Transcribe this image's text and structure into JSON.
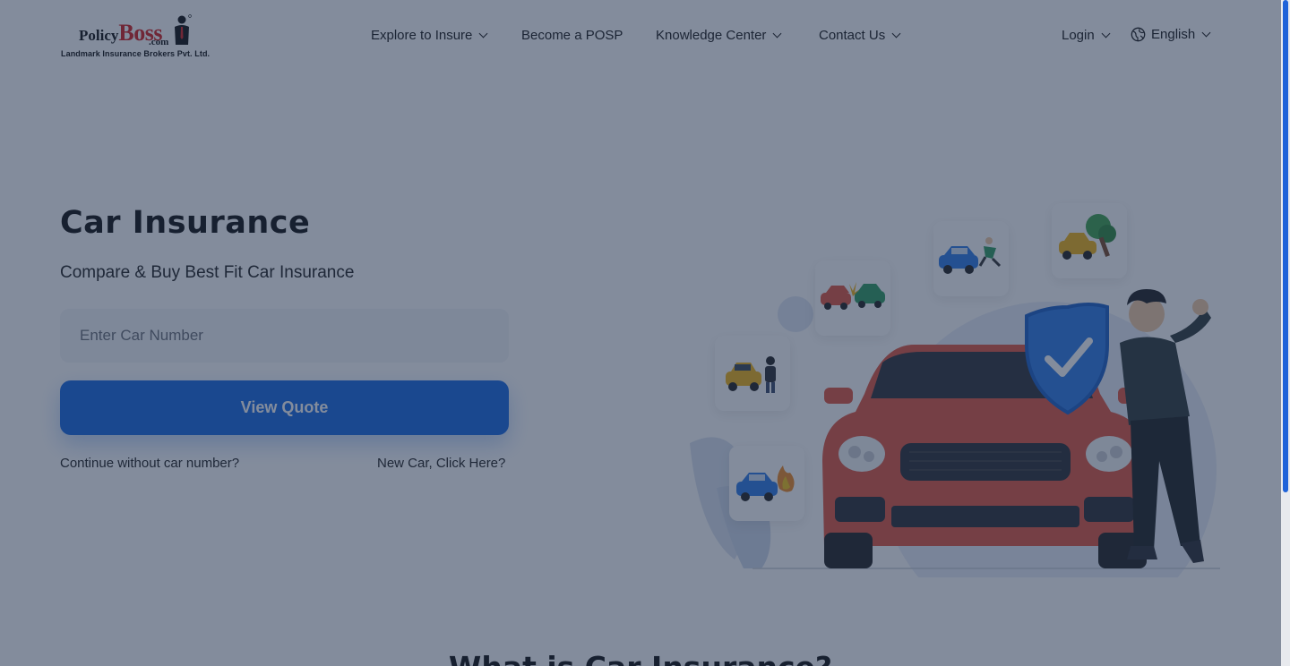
{
  "logo": {
    "policy": "Policy",
    "boss": "Boss",
    "com": ".com",
    "subtitle": "Landmark Insurance Brokers Pvt. Ltd."
  },
  "nav": {
    "items": [
      {
        "label": "Explore to Insure",
        "has_dropdown": true
      },
      {
        "label": "Become a POSP",
        "has_dropdown": false
      },
      {
        "label": "Knowledge Center",
        "has_dropdown": true
      },
      {
        "label": "Contact Us",
        "has_dropdown": true
      }
    ],
    "login": "Login",
    "language": "English"
  },
  "hero": {
    "title": "Car Insurance",
    "subtitle": "Compare & Buy Best Fit Car Insurance",
    "input_placeholder": "Enter Car Number",
    "button_label": "View Quote",
    "link_without_number": "Continue without car number?",
    "link_new_car": "New Car, Click Here?"
  },
  "section": {
    "heading": "What is Car Insurance?"
  },
  "colors": {
    "primary": "#1768e2",
    "brand_red": "#d6201f",
    "car_red": "#e0543f",
    "overlay": "rgba(30,45,75,0.55)"
  },
  "icons": {
    "language": "globe-icon",
    "dropdown": "chevron-down-icon"
  }
}
